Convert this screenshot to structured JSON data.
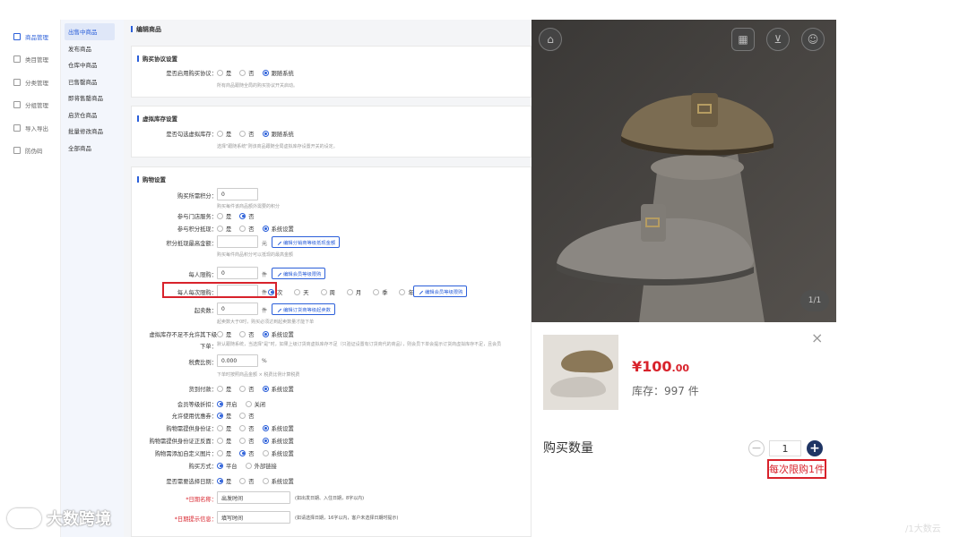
{
  "primary_nav": [
    {
      "label": "商品管理",
      "icon": "bag-icon",
      "active": true
    },
    {
      "label": "类目管理",
      "icon": "category-icon",
      "active": false
    },
    {
      "label": "分类管理",
      "icon": "tag-icon",
      "active": false
    },
    {
      "label": "分组管理",
      "icon": "group-icon",
      "active": false
    },
    {
      "label": "导入导出",
      "icon": "import-icon",
      "active": false
    },
    {
      "label": "防伪码",
      "icon": "code-icon",
      "active": false
    }
  ],
  "secondary_nav": [
    {
      "label": "出售中商品",
      "active": true
    },
    {
      "label": "发布商品",
      "active": false
    },
    {
      "label": "仓库中商品",
      "active": false
    },
    {
      "label": "已售罄商品",
      "active": false
    },
    {
      "label": "即将售罄商品",
      "active": false
    },
    {
      "label": "启货仓商品",
      "active": false
    },
    {
      "label": "批量修改商品",
      "active": false
    },
    {
      "label": "全部商品",
      "active": false
    }
  ],
  "page_title": "编辑商品",
  "sections": {
    "agreement": {
      "title": "购买协议设置",
      "label": "是否启用购买协议：",
      "options": [
        "是",
        "否",
        "跟随系统"
      ],
      "hint": "所有商品跟随全局的购买协议开关启动。"
    },
    "virtual": {
      "title": "虚拟库存设置",
      "label": "是否勾选虚拟库存：",
      "options": [
        "是",
        "否",
        "跟随系统"
      ],
      "hint": "选择\"跟随系统\"则该商品跟随全局虚拟库存设置开关的设定。"
    },
    "purchase": {
      "title": "购物设置",
      "points_label": "购买所需积分：",
      "points_value": "0",
      "points_hint": "购买每件该商品额外需要的积分",
      "store_label": "参与门店服务：",
      "store_options": [
        "是",
        "否"
      ],
      "points_deduct_label": "参与积分抵现：",
      "points_deduct_options": [
        "是",
        "否",
        "系统设置"
      ],
      "max_deduct_label": "积分抵现最高金额：",
      "max_deduct_unit": "元",
      "max_deduct_btn": "编辑分销商等级抵现金额",
      "max_deduct_hint": "购买每件商品积分可以抵现的最高金额",
      "limit_label": "每人限购：",
      "limit_value": "0",
      "limit_unit": "件",
      "limit_btn": "编辑会员等级限购",
      "period_label": "每人每次限购：",
      "period_unit": "件",
      "period_options": [
        "次",
        "天",
        "周",
        "月",
        "季",
        "年"
      ],
      "period_btn": "编辑会员等级限购",
      "min_label": "起卖数：",
      "min_value": "0",
      "min_unit": "件",
      "min_btn": "编辑订货商等级起卖数",
      "min_hint": "起卖数大于0时，购买必须达到起卖数量才能下单",
      "vstock_label_1": "虚拟库存不足不允许其下级",
      "vstock_label_2": "下单：",
      "vstock_options": [
        "是",
        "否",
        "系统设置"
      ],
      "vstock_hint": "默认跟随系统，当选择\"是\"时，如果上级订货商虚拟库存不足（只验证设置有订货商代的商品），则会员下单会提示订货商虚拟库存不足，且会员",
      "tax_label": "税费比例：",
      "tax_value": "0.000",
      "tax_unit": "%",
      "tax_hint": "下单时按照商品金额 × 税费比例计算税费",
      "cod_label": "货到付款：",
      "cod_options": [
        "是",
        "否",
        "系统设置"
      ],
      "member_discount_label": "会员等级折扣：",
      "member_discount_options": [
        "开启",
        "关闭"
      ],
      "coupon_label": "允许使用优惠券：",
      "coupon_options": [
        "是",
        "否"
      ],
      "idcard_label": "购物需提供身份证：",
      "idcard_options": [
        "是",
        "否",
        "系统设置"
      ],
      "idphoto_label": "购物需提供身份证正反面：",
      "idphoto_options": [
        "是",
        "否",
        "系统设置"
      ],
      "customimg_label": "购物需添加自定义图片：",
      "customimg_options": [
        "是",
        "否",
        "系统设置"
      ],
      "buymode_label": "购买方式：",
      "buymode_options": [
        "平台",
        "外部链接"
      ],
      "date_label": "是否需要选择日期：",
      "date_options": [
        "是",
        "否",
        "系统设置"
      ],
      "datename_label": "*日期名称：",
      "datename_value": "出发时间",
      "datename_hint": "(如出发日期、入住日期，8字以内)",
      "datetip_label": "*日期提示信息：",
      "datetip_value": "填写时间",
      "datetip_hint": "(如请选择日期，16字以内，客户未选择日期时提示)"
    }
  },
  "product_popup": {
    "icons": [
      "home-icon",
      "qrcode-icon",
      "cart-icon",
      "user-icon"
    ],
    "image_counter": "1/1",
    "price_symbol": "¥",
    "price_int": "100",
    "price_dec": ".00",
    "stock": "库存：997 件",
    "qty_label": "购买数量",
    "qty_value": "1",
    "limit_note": "每次限购1件",
    "close": "×"
  },
  "watermark_left": "大数跨境",
  "watermark_right": "/1大数云"
}
